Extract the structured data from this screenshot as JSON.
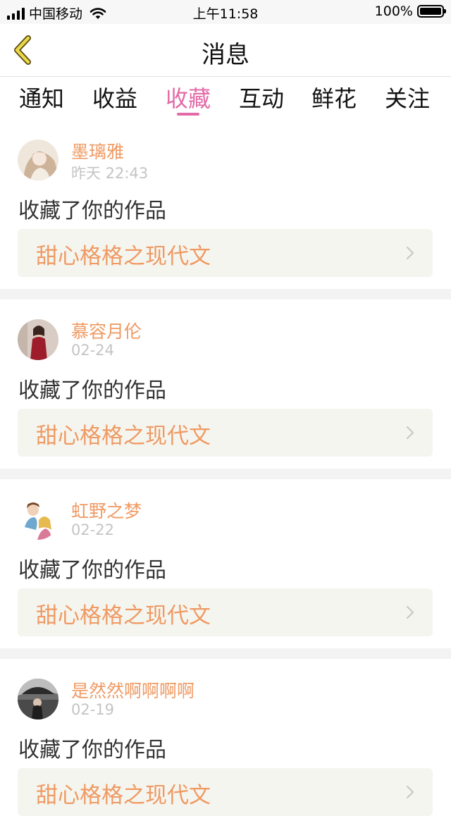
{
  "status_bar": {
    "carrier": "中国移动",
    "time": "上午11:58",
    "battery": "100%"
  },
  "nav": {
    "title": "消息",
    "back_icon": "chevron-left-icon"
  },
  "tabs": [
    {
      "label": "通知",
      "active": false
    },
    {
      "label": "收益",
      "active": false
    },
    {
      "label": "收藏",
      "active": true
    },
    {
      "label": "互动",
      "active": false
    },
    {
      "label": "鲜花",
      "active": false
    },
    {
      "label": "关注",
      "active": false
    }
  ],
  "colors": {
    "accent_pink": "#e36aa7",
    "name_orange": "#ef9a63",
    "card_bg": "#f5f5ef"
  },
  "messages": [
    {
      "user": "墨璃雅",
      "time": "昨天 22:43",
      "text": "收藏了你的作品",
      "work": "甜心格格之现代文"
    },
    {
      "user": "慕容月伦",
      "time": "02-24",
      "text": "收藏了你的作品",
      "work": "甜心格格之现代文"
    },
    {
      "user": "虹野之梦",
      "time": "02-22",
      "text": "收藏了你的作品",
      "work": "甜心格格之现代文"
    },
    {
      "user": "是然然啊啊啊啊",
      "time": "02-19",
      "text": "收藏了你的作品",
      "work": "甜心格格之现代文"
    }
  ]
}
